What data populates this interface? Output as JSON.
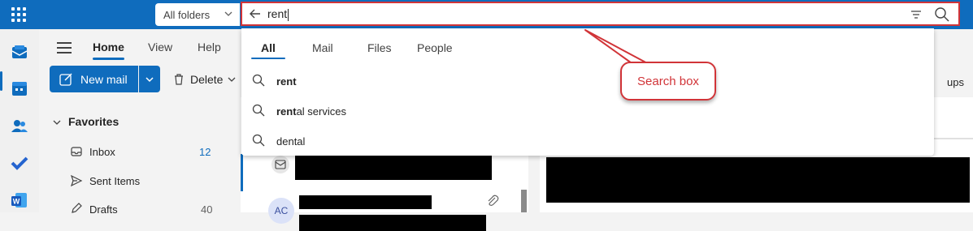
{
  "header": {
    "scope_select": "All folders",
    "search_query_bold": "rent",
    "search_query": "rent"
  },
  "nav": {
    "tabs": [
      "Home",
      "View",
      "Help"
    ]
  },
  "ribbon": {
    "new_mail": "New mail",
    "delete": "Delete",
    "groups_partial": "ups"
  },
  "folders": {
    "favorites": "Favorites",
    "items": [
      {
        "label": "Inbox",
        "count": "12"
      },
      {
        "label": "Sent Items",
        "count": ""
      },
      {
        "label": "Drafts",
        "count": "40"
      }
    ]
  },
  "message_list": {
    "avatar_initials": "AC"
  },
  "search_dropdown": {
    "tabs": [
      "All",
      "Mail",
      "Files",
      "People"
    ],
    "suggestions": [
      {
        "bold": "rent",
        "rest": ""
      },
      {
        "bold": "rent",
        "rest": "al services"
      },
      {
        "bold": "",
        "rest": "dental"
      }
    ]
  },
  "annotation": {
    "callout_text": "Search box",
    "color": "#d13438"
  },
  "colors": {
    "brand": "#0f6cbd",
    "annotation_red": "#d13438"
  }
}
